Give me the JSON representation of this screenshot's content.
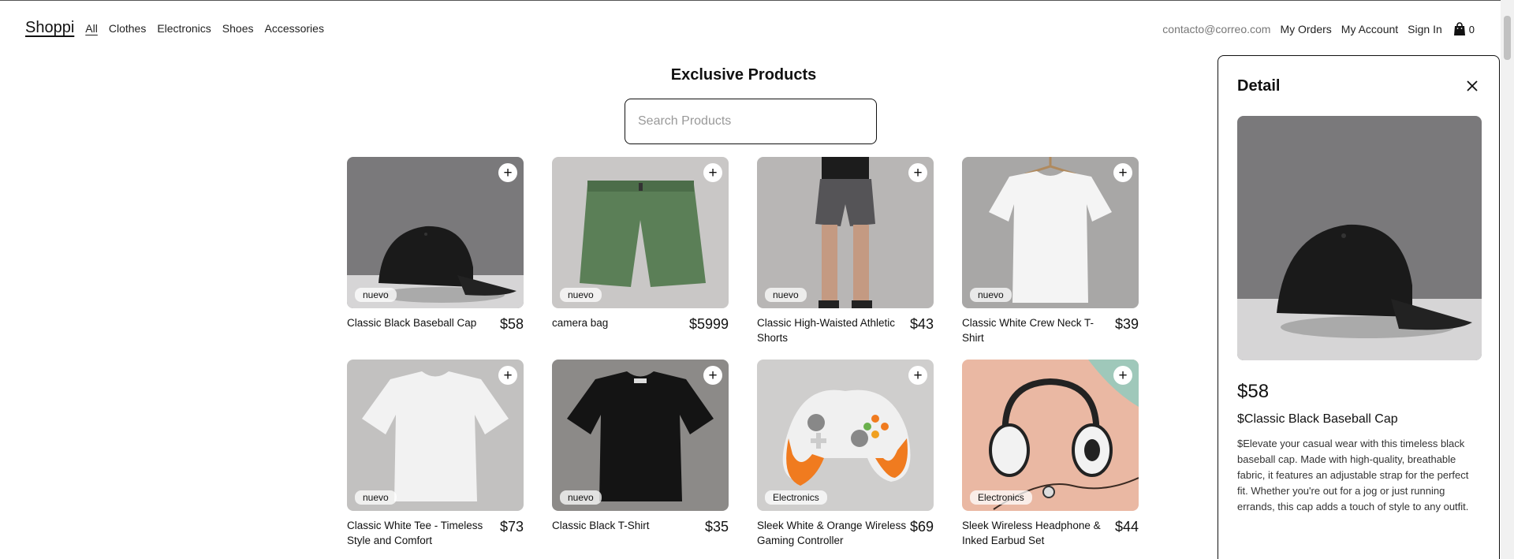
{
  "nav": {
    "logo": "Shoppi",
    "categories": [
      "All",
      "Clothes",
      "Electronics",
      "Shoes",
      "Accessories"
    ],
    "email": "contacto@correo.com",
    "my_orders": "My Orders",
    "my_account": "My Account",
    "sign_in": "Sign In",
    "cart_count": "0",
    "cart_icon": "shopping-bag-icon"
  },
  "main": {
    "title": "Exclusive Products",
    "search_placeholder": "Search Products"
  },
  "products": [
    {
      "name": "Classic Black Baseball Cap",
      "price": "$58",
      "badge": "nuevo",
      "image": "black-cap"
    },
    {
      "name": "camera bag",
      "price": "$5999",
      "badge": "nuevo",
      "image": "green-shorts"
    },
    {
      "name": "Classic High-Waisted Athletic Shorts",
      "price": "$43",
      "badge": "nuevo",
      "image": "athletic-shorts"
    },
    {
      "name": "Classic White Crew Neck T-Shirt",
      "price": "$39",
      "badge": "nuevo",
      "image": "white-tshirt-hanger"
    },
    {
      "name": "Classic White Tee - Timeless Style and Comfort",
      "price": "$73",
      "badge": "nuevo",
      "image": "white-tee"
    },
    {
      "name": "Classic Black T-Shirt",
      "price": "$35",
      "badge": "nuevo",
      "image": "black-tee"
    },
    {
      "name": "Sleek White & Orange Wireless Gaming Controller",
      "price": "$69",
      "badge": "Electronics",
      "image": "game-controller"
    },
    {
      "name": "Sleek Wireless Headphone & Inked Earbud Set",
      "price": "$44",
      "badge": "Electronics",
      "image": "headphones"
    }
  ],
  "detail": {
    "title": "Detail",
    "price": "$58",
    "name": "$Classic Black Baseball Cap",
    "description": "$Elevate your casual wear with this timeless black baseball cap. Made with high-quality, breathable fabric, it features an adjustable strap for the perfect fit. Whether you're out for a jog or just running errands, this cap adds a touch of style to any outfit."
  },
  "colors": {
    "accent": "#111111",
    "muted_text": "#777777",
    "border": "#111111"
  }
}
